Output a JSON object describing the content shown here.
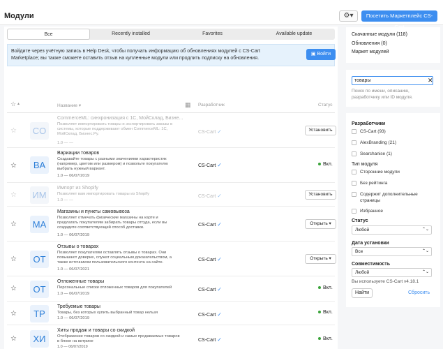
{
  "header": {
    "title": "Модули",
    "gear_label": "⚙▾",
    "marketplace_button": "Посетить Маркетплейс CS-Cart"
  },
  "tabs": [
    {
      "label": "Все",
      "active": true
    },
    {
      "label": "Recently installed",
      "active": false
    },
    {
      "label": "Favorites",
      "active": false
    },
    {
      "label": "Available update",
      "active": false
    }
  ],
  "notice": {
    "text": "Войдите через учётную запись в Help Desk, чтобы получать информацию об обновлениях модулей с CS-Cart Marketplace; вы также сможете оставить отзыв на купленные модули или продлить подписку на обновления.",
    "login_button": "Войти"
  },
  "table": {
    "col_name": "Название ▾",
    "col_developer": "Разработчик",
    "col_status": "Статус"
  },
  "addons": [
    {
      "initials": "CO",
      "title": "CommerceML: синхронизация с 1С, МойСклад, Бизне...",
      "desc": "Позволяет импортировать товары и экспортировать заказы в системы, которые поддерживают обмен CommerceML: 1С, МойСклад, Бизнес.Ру.",
      "version": "1.0 — —",
      "developer": "CS-Cart",
      "status": "",
      "action": "Установить",
      "installed": false
    },
    {
      "initials": "BA",
      "title": "Вариации товаров",
      "desc": "Создавайте товары с разными значениями характеристик (например, цветом или размером) и позвольте покупателю выбрать нужный вариант.",
      "version": "1.0 — 06/07/2019",
      "developer": "CS-Cart",
      "status": "Вкл.",
      "action": "",
      "installed": true
    },
    {
      "initials": "ИМ",
      "title": "Импорт из Shopify",
      "desc": "Позволяет вам импортировать товары из Shopify",
      "version": "1.0 — —",
      "developer": "CS-Cart",
      "status": "",
      "action": "Установить",
      "installed": false
    },
    {
      "initials": "MA",
      "title": "Магазины и пункты самовывоза",
      "desc": "Позволяет отмечать физические магазины на карте и предлагать покупателям забирать товары оттуда, если вы создадите соответствующий способ доставки.",
      "version": "1.0 — 06/07/2019",
      "developer": "CS-Cart",
      "status": "",
      "action": "Открыть ▾",
      "installed": true
    },
    {
      "initials": "OT",
      "title": "Отзывы о товарах",
      "desc": "Позволяет покупателям оставлять отзывы о товарах. Они повышают доверие, служат социальным доказательством, а также источником пользовательского контента на сайте.",
      "version": "1.0 — 06/07/2021",
      "developer": "CS-Cart",
      "status": "",
      "action": "Открыть ▾",
      "installed": true
    },
    {
      "initials": "OT",
      "title": "Отложенные товары",
      "desc": "Персональные списки отложенных товаров для покупателей",
      "version": "1.0 — 06/07/2019",
      "developer": "CS-Cart",
      "status": "Вкл.",
      "action": "",
      "installed": true
    },
    {
      "initials": "TP",
      "title": "Требуемые товары",
      "desc": "Товары, без которых купить выбранный товар нельзя",
      "version": "1.0 — 06/07/2019",
      "developer": "CS-Cart",
      "status": "Вкл.",
      "action": "",
      "installed": true
    },
    {
      "initials": "ХИ",
      "title": "Хиты продаж и товары со скидкой",
      "desc": "Отображение товаров со скидкой и самых продаваемых товаров в блоке на витрине",
      "version": "1.0 — 06/07/2019",
      "developer": "CS-Cart",
      "status": "Вкл.",
      "action": "",
      "installed": true
    }
  ],
  "sidebar": {
    "nav": [
      "Скачанные модули (118)",
      "Обновления (0)",
      "Маркет модулей"
    ],
    "search_value": "товары",
    "search_clear": "✕",
    "search_hint": "Поиск по имени, описанию, разработчику или ID модуля.",
    "developers_title": "Разработчики",
    "developers": [
      "CS-Cart (93)",
      "AlexBranding (21)",
      "Searchanise (1)"
    ],
    "type_title": "Тип модуля",
    "types": [
      "Сторонние модули",
      "Без рейтинга",
      "Содержит дополнительные страницы",
      "Избранное"
    ],
    "status_title": "Статус",
    "status_value": "Любой",
    "install_date_title": "Дата установки",
    "install_date_value": "Все",
    "compat_title": "Совместимость",
    "compat_value": "Любой",
    "cs_version_note": "Вы используете CS-Cart v4.18.1",
    "find_button": "Найти",
    "reset_link": "Сбросить"
  }
}
